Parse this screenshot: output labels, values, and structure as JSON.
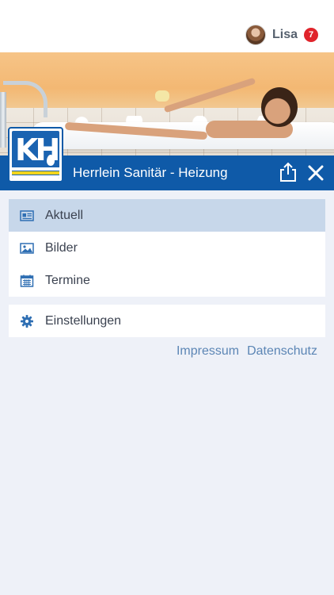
{
  "user": {
    "name": "Lisa",
    "notification_count": "7"
  },
  "header": {
    "title": "Herrlein Sanitär - Heizung"
  },
  "menu": {
    "items": [
      {
        "label": "Aktuell",
        "icon": "newspaper-icon",
        "active": true
      },
      {
        "label": "Bilder",
        "icon": "image-icon",
        "active": false
      },
      {
        "label": "Termine",
        "icon": "calendar-icon",
        "active": false
      }
    ],
    "settings": {
      "label": "Einstellungen",
      "icon": "gear-icon"
    }
  },
  "footer": {
    "impressum": "Impressum",
    "datenschutz": "Datenschutz"
  },
  "colors": {
    "brand_blue": "#0f5aa8",
    "active_item": "#c7d7ea",
    "background": "#eef1f8",
    "badge_red": "#e0242b",
    "link": "#5c86b5"
  }
}
